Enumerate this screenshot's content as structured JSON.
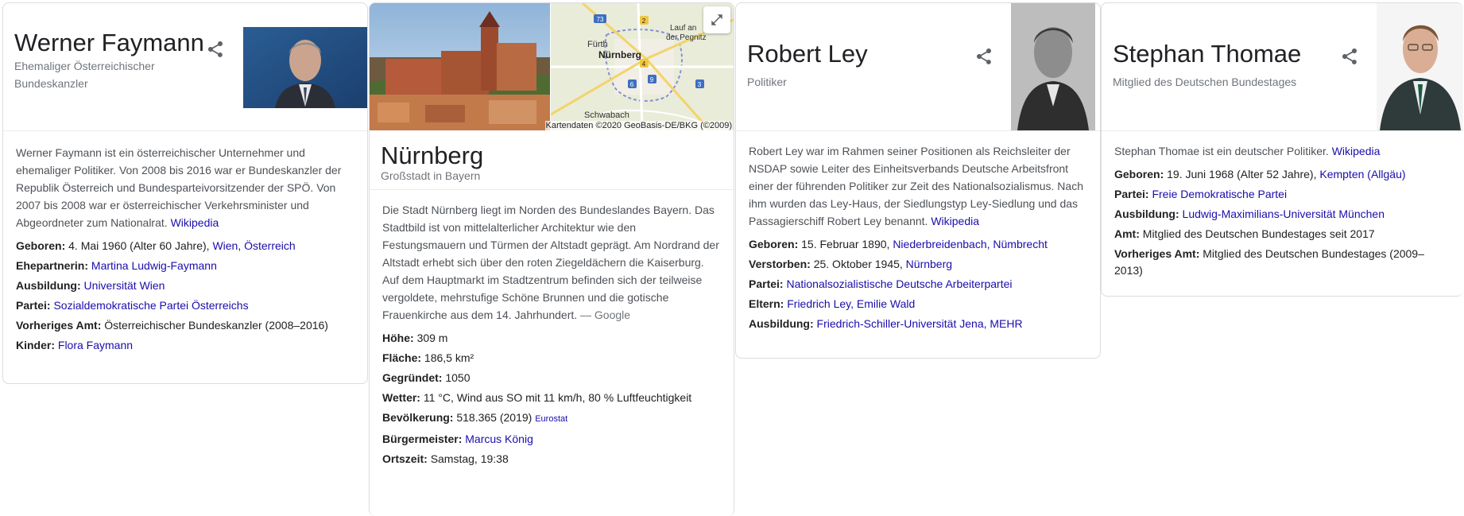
{
  "panels": [
    {
      "title": "Werner Faymann",
      "subtitle_line1": "Ehemaliger Österreichischer",
      "subtitle_line2": "Bundeskanzler",
      "description": "Werner Faymann ist ein österreichischer Unternehmer und ehemaliger Politiker. Von 2008 bis 2016 war er Bundeskanzler der Republik Österreich und Bundesparteivorsitzender der SPÖ. Von 2007 bis 2008 war er österreichischer Verkehrsminister und Abgeordneter zum Nationalrat.",
      "source": "Wikipedia",
      "facts": [
        {
          "label": "Geboren:",
          "text": "4. Mai 1960 (Alter 60 Jahre),",
          "link": "Wien, Österreich"
        },
        {
          "label": "Ehepartnerin:",
          "text": "",
          "link": "Martina Ludwig-Faymann"
        },
        {
          "label": "Ausbildung:",
          "text": "",
          "link": "Universität Wien"
        },
        {
          "label": "Partei:",
          "text": "",
          "link": "Sozialdemokratische Partei Österreichs"
        },
        {
          "label": "Vorheriges Amt:",
          "text": "Österreichischer Bundeskanzler (2008–2016)",
          "link": ""
        },
        {
          "label": "Kinder:",
          "text": "",
          "link": "Flora Faymann"
        }
      ]
    },
    {
      "map_labels": {
        "fuerth": "Fürth",
        "lauf1": "Lauf an",
        "lauf2": "der Pegnitz",
        "nuernberg": "Nürnberg",
        "schwabach": "Schwabach",
        "r73": "73",
        "r2": "2",
        "r4": "4",
        "r6": "6",
        "r9": "9",
        "r3": "3"
      },
      "map_attribution": "Kartendaten ©2020 GeoBasis-DE/BKG (©2009)",
      "title": "Nürnberg",
      "subtitle": "Großstadt in Bayern",
      "description": "Die Stadt Nürnberg liegt im Norden des Bundeslandes Bayern. Das Stadtbild ist von mittelalterlicher Architektur wie den Festungsmauern und Türmen der Altstadt geprägt. Am Nordrand der Altstadt erhebt sich über den roten Ziegeldächern die Kaiserburg. Auf dem Hauptmarkt im Stadtzentrum befinden sich der teilweise vergoldete, mehrstufige Schöne Brunnen und die gotische Frauenkirche aus dem 14. Jahrhundert.",
      "source": "— Google",
      "facts": [
        {
          "label": "Höhe:",
          "text": "309 m",
          "link": ""
        },
        {
          "label": "Fläche:",
          "text": "186,5 km²",
          "link": ""
        },
        {
          "label": "Gegründet:",
          "text": "1050",
          "link": ""
        },
        {
          "label": "Wetter:",
          "text": "11 °C, Wind aus SO mit 11 km/h, 80 % Luftfeuchtigkeit",
          "link": ""
        },
        {
          "label": "Bevölkerung:",
          "text": "518.365 (2019)",
          "link": "Eurostat"
        },
        {
          "label": "Bürgermeister:",
          "text": "",
          "link": "Marcus König"
        },
        {
          "label": "Ortszeit:",
          "text": "Samstag, 19:38",
          "link": ""
        }
      ]
    },
    {
      "title": "Robert Ley",
      "subtitle": "Politiker",
      "description": "Robert Ley war im Rahmen seiner Positionen als Reichsleiter der NSDAP sowie Leiter des Einheitsverbands Deutsche Arbeitsfront einer der führenden Politiker zur Zeit des Nationalsozialismus. Nach ihm wurden das Ley-Haus, der Siedlungstyp Ley-Siedlung und das Passagierschiff Robert Ley benannt.",
      "source": "Wikipedia",
      "facts": [
        {
          "label": "Geboren:",
          "text": "15. Februar 1890,",
          "link": "Niederbreidenbach, Nümbrecht"
        },
        {
          "label": "Verstorben:",
          "text": "25. Oktober 1945,",
          "link": "Nürnberg"
        },
        {
          "label": "Partei:",
          "text": "",
          "link": "Nationalsozialistische Deutsche Arbeiterpartei"
        },
        {
          "label": "Eltern:",
          "text": "",
          "link": "Friedrich Ley, Emilie Wald"
        },
        {
          "label": "Ausbildung:",
          "text": "",
          "link": "Friedrich-Schiller-Universität Jena, MEHR"
        }
      ]
    },
    {
      "title": "Stephan Thomae",
      "subtitle": "Mitglied des Deutschen Bundestages",
      "description": "Stephan Thomae ist ein deutscher Politiker.",
      "source": "Wikipedia",
      "facts": [
        {
          "label": "Geboren:",
          "text": "19. Juni 1968 (Alter 52 Jahre),",
          "link": "Kempten (Allgäu)"
        },
        {
          "label": "Partei:",
          "text": "",
          "link": "Freie Demokratische Partei"
        },
        {
          "label": "Ausbildung:",
          "text": "",
          "link": "Ludwig-Maximilians-Universität München"
        },
        {
          "label": "Amt:",
          "text": "Mitglied des Deutschen Bundestages seit 2017",
          "link": ""
        },
        {
          "label": "Vorheriges Amt:",
          "text": "Mitglied des Deutschen Bundestages (2009–2013)",
          "link": ""
        }
      ]
    }
  ],
  "colors": {
    "link": "#1a0dab",
    "muted": "#70757a",
    "body_text": "#4d5156",
    "border": "#dadce0"
  },
  "icons": [
    "share-icon",
    "expand-icon"
  ]
}
